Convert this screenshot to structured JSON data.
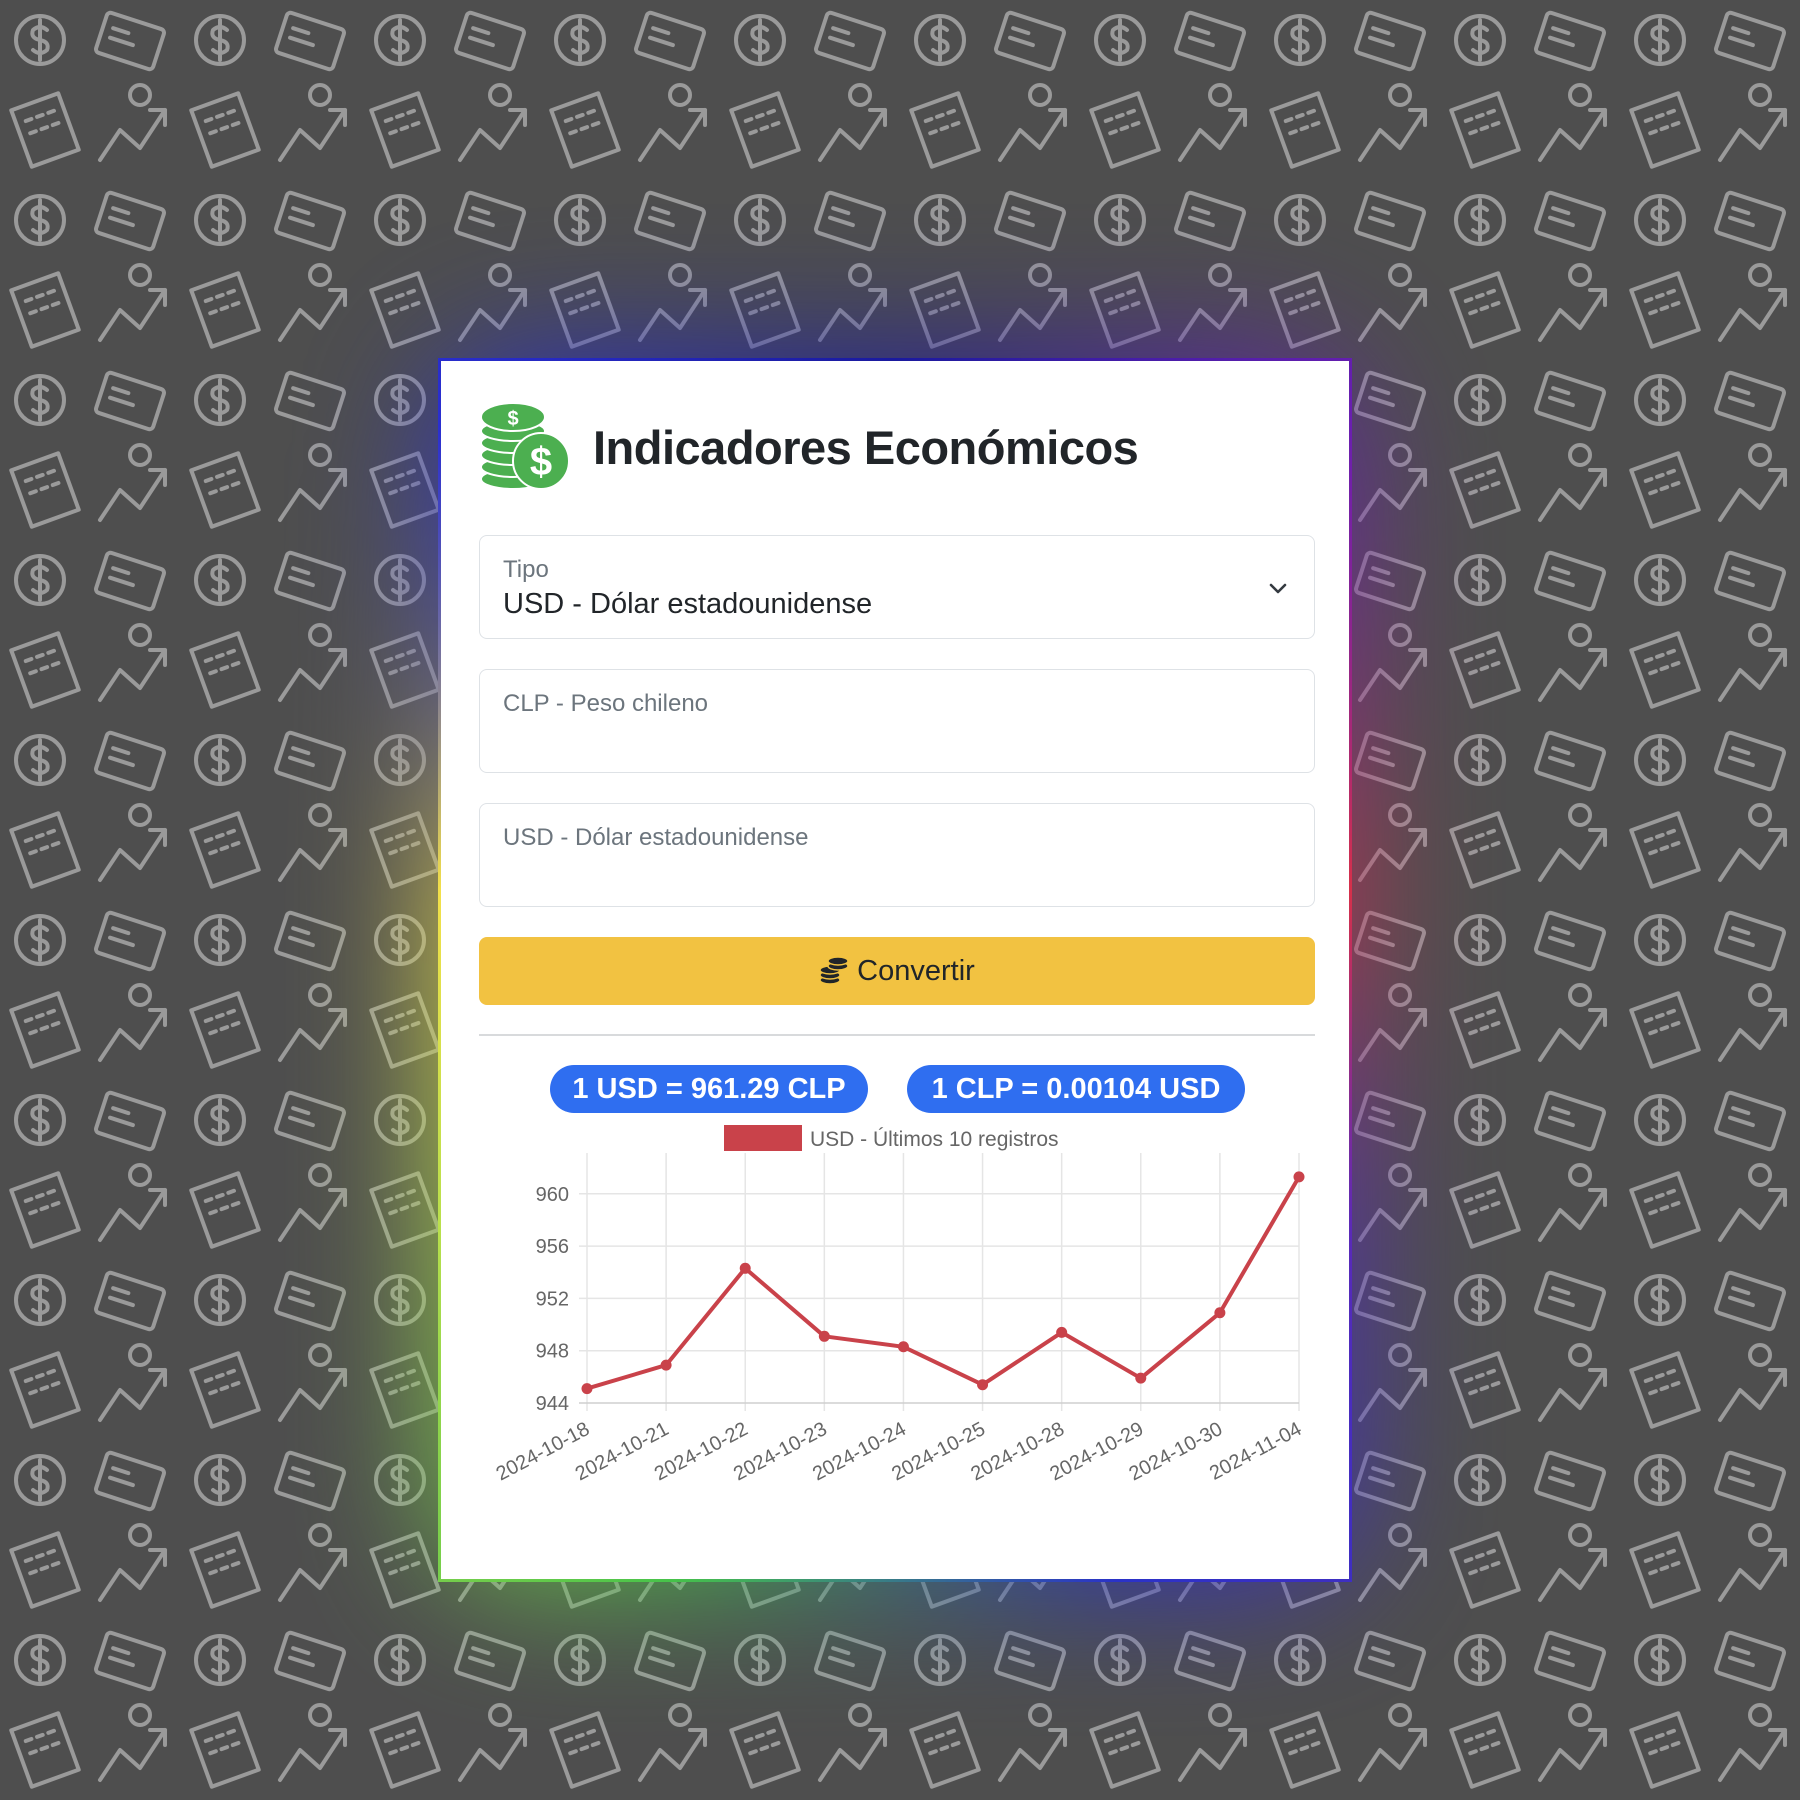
{
  "header": {
    "title": "Indicadores Económicos",
    "logo_icon": "money-coins-icon"
  },
  "form": {
    "type_label": "Tipo",
    "type_value": "USD - Dólar estadounidense",
    "clp_placeholder": "CLP - Peso chileno",
    "usd_placeholder": "USD - Dólar estadounidense",
    "convert_label": "Convertir"
  },
  "rates": {
    "usd_to_clp": "1 USD = 961.29 CLP",
    "clp_to_usd": "1 CLP = 0.00104 USD"
  },
  "colors": {
    "accent": "#f2c241",
    "badge": "#2f6ef0",
    "series": "#c9424a"
  },
  "chart_data": {
    "type": "line",
    "categories": [
      "2024-10-18",
      "2024-10-21",
      "2024-10-22",
      "2024-10-23",
      "2024-10-24",
      "2024-10-25",
      "2024-10-28",
      "2024-10-29",
      "2024-10-30",
      "2024-11-04"
    ],
    "series": [
      {
        "name": "USD - Últimos 10 registros",
        "values": [
          945.1,
          946.9,
          954.3,
          949.1,
          948.3,
          945.4,
          949.4,
          945.9,
          950.9,
          961.29
        ]
      }
    ],
    "yticks": [
      944,
      948,
      952,
      956,
      960
    ],
    "ylim": [
      944,
      961.29
    ],
    "grid": true,
    "legend": "top"
  }
}
